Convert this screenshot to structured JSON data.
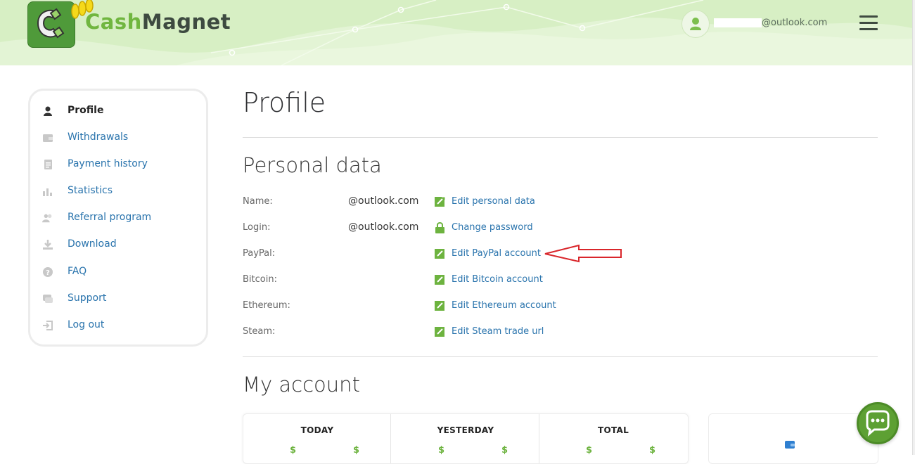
{
  "header": {
    "logo_word1": "Cash",
    "logo_word2": "Magnet",
    "user_email": "@outlook.com"
  },
  "sidebar": {
    "items": [
      {
        "label": "Profile",
        "icon": "user-icon",
        "active": true
      },
      {
        "label": "Withdrawals",
        "icon": "wallet-icon"
      },
      {
        "label": "Payment history",
        "icon": "document-icon"
      },
      {
        "label": "Statistics",
        "icon": "bar-chart-icon"
      },
      {
        "label": "Referral program",
        "icon": "users-icon"
      },
      {
        "label": "Download",
        "icon": "download-icon"
      },
      {
        "label": "FAQ",
        "icon": "question-icon"
      },
      {
        "label": "Support",
        "icon": "chat-icon"
      },
      {
        "label": "Log out",
        "icon": "logout-icon"
      }
    ]
  },
  "main": {
    "page_title": "Profile",
    "personal_data": {
      "title": "Personal data",
      "rows": [
        {
          "key": "Name:",
          "value": "@outlook.com",
          "action": "Edit personal data",
          "action_icon": "edit-icon"
        },
        {
          "key": "Login:",
          "value": "@outlook.com",
          "action": "Change password",
          "action_icon": "lock-icon"
        },
        {
          "key": "PayPal:",
          "value": "",
          "action": "Edit PayPal account",
          "action_icon": "edit-icon"
        },
        {
          "key": "Bitcoin:",
          "value": "",
          "action": "Edit Bitcoin account",
          "action_icon": "edit-icon"
        },
        {
          "key": "Ethereum:",
          "value": "",
          "action": "Edit Ethereum account",
          "action_icon": "edit-icon"
        },
        {
          "key": "Steam:",
          "value": "",
          "action": "Edit Steam trade url",
          "action_icon": "edit-icon"
        }
      ]
    },
    "my_account": {
      "title": "My account",
      "columns": [
        "TODAY",
        "YESTERDAY",
        "TOTAL"
      ],
      "currency_symbol": "$"
    }
  },
  "colors": {
    "accent_green": "#70b63f",
    "link_blue": "#2a74ad",
    "header_bg": "#d7efc4",
    "annotation_red": "#d9262b"
  }
}
